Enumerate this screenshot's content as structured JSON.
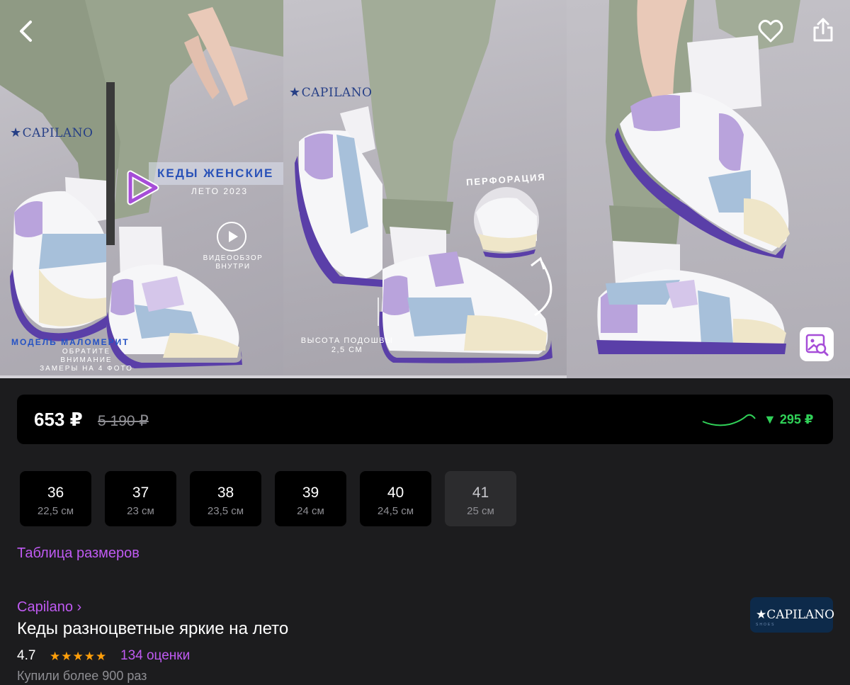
{
  "gallery": {
    "photo1": {
      "logo": "CAPILANO",
      "promo_title": "КЕДЫ ЖЕНСКИЕ",
      "promo_subtitle": "ЛЕТО 2023",
      "video_label_1": "ВИДЕООБЗОР",
      "video_label_2": "ВНУТРИ",
      "note_title": "МОДЕЛЬ МАЛОМЕРИТ",
      "note_line_1": "ОБРАТИТЕ ВНИМАНИЕ",
      "note_line_2": "ЗАМЕРЫ НА 4 ФОТО"
    },
    "photo2": {
      "logo": "CAPILANO",
      "perforation": "ПЕРФОРАЦИЯ",
      "sole_label_1": "ВЫСОТА ПОДОШВЫ",
      "sole_label_2": "2,5 СМ"
    },
    "icons": {
      "back": "chevron-left-icon",
      "favorite": "heart-icon",
      "share": "share-icon",
      "search_by_photo": "image-search-icon",
      "play": "play-icon"
    }
  },
  "price": {
    "current": "653 ₽",
    "old": "5 190 ₽",
    "drop": "▼ 295 ₽",
    "drop_color": "#30d158"
  },
  "sizes": [
    {
      "size": "36",
      "cm": "22,5 см",
      "available": true
    },
    {
      "size": "37",
      "cm": "23 см",
      "available": true
    },
    {
      "size": "38",
      "cm": "23,5 см",
      "available": true
    },
    {
      "size": "39",
      "cm": "24 см",
      "available": true
    },
    {
      "size": "40",
      "cm": "24,5 см",
      "available": true
    },
    {
      "size": "41",
      "cm": "25 см",
      "available": false
    }
  ],
  "size_table_link": "Таблица размеров",
  "product": {
    "brand": "Capilano ›",
    "title": "Кеды разноцветные яркие на лето",
    "rating": "4.7",
    "stars": "★★★★★",
    "reviews": "134 оценки",
    "purchases": "Купили более 900 раз",
    "brand_badge": "CAPILANO",
    "brand_badge_sub": "SHOES"
  },
  "colors": {
    "accent": "#bf5af2",
    "background": "#1c1c1e",
    "card": "#000000",
    "star": "#ff9f0a"
  }
}
